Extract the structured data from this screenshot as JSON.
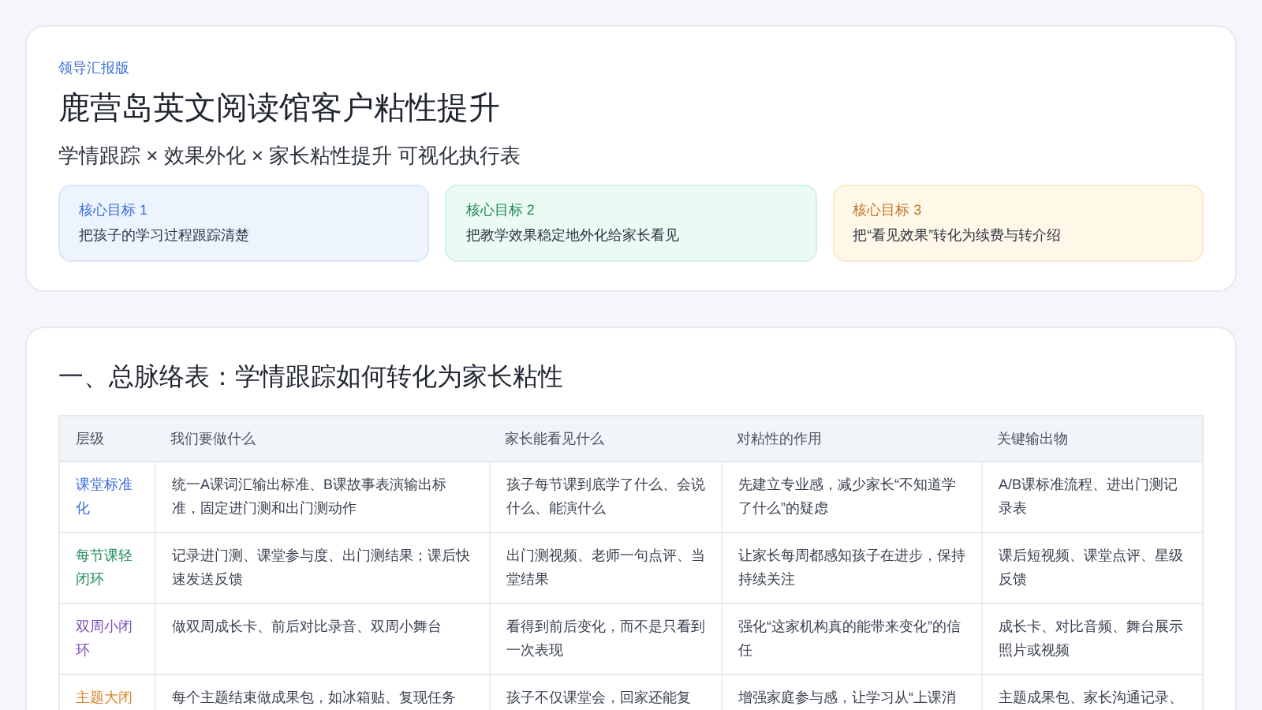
{
  "header": {
    "eyebrow": "领导汇报版",
    "title": "鹿营岛英文阅读馆客户粘性提升",
    "subtitle": "学情跟踪 × 效果外化 × 家长粘性提升 可视化执行表",
    "goals": [
      {
        "label": "核心目标 1",
        "text": "把孩子的学习过程跟踪清楚",
        "color": "#3b6fd8"
      },
      {
        "label": "核心目标 2",
        "text": "把教学效果稳定地外化给家长看见",
        "color": "#1f8a5a"
      },
      {
        "label": "核心目标 3",
        "text": "把“看见效果”转化为续费与转介绍",
        "color": "#c0762a"
      }
    ]
  },
  "section": {
    "title": "一、总脉络表：学情跟踪如何转化为家长粘性",
    "table": {
      "columns": [
        "层级",
        "我们要做什么",
        "家长能看见什么",
        "对粘性的作用",
        "关键输出物"
      ],
      "rows": [
        {
          "color": "#3b6fd8",
          "cells": [
            "课堂标准化",
            "统一A课词汇输出标准、B课故事表演输出标准，固定进门测和出门测动作",
            "孩子每节课到底学了什么、会说什么、能演什么",
            "先建立专业感，减少家长“不知道学了什么”的疑虑",
            "A/B课标准流程、进出门测记录表"
          ]
        },
        {
          "color": "#1f8a5a",
          "cells": [
            "每节课轻闭环",
            "记录进门测、课堂参与度、出门测结果；课后快速发送反馈",
            "出门测视频、老师一句点评、当堂结果",
            "让家长每周都感知孩子在进步，保持持续关注",
            "课后短视频、课堂点评、星级反馈"
          ]
        },
        {
          "color": "#7c4dbd",
          "cells": [
            "双周小闭环",
            "做双周成长卡、前后对比录音、双周小舞台",
            "看得到前后变化，而不是只看到一次表现",
            "强化“这家机构真的能带来变化”的信任",
            "成长卡、对比音频、舞台展示照片或视频"
          ]
        },
        {
          "color": "#d9822b",
          "cells": [
            "主题大闭",
            "每个主题结束做成果包，如冰箱贴、复现任务",
            "孩子不仅课堂会，回家还能复",
            "增强家庭参与感，让学习从“上课消",
            "主题成果包、家长沟通记录、"
          ]
        }
      ]
    }
  }
}
